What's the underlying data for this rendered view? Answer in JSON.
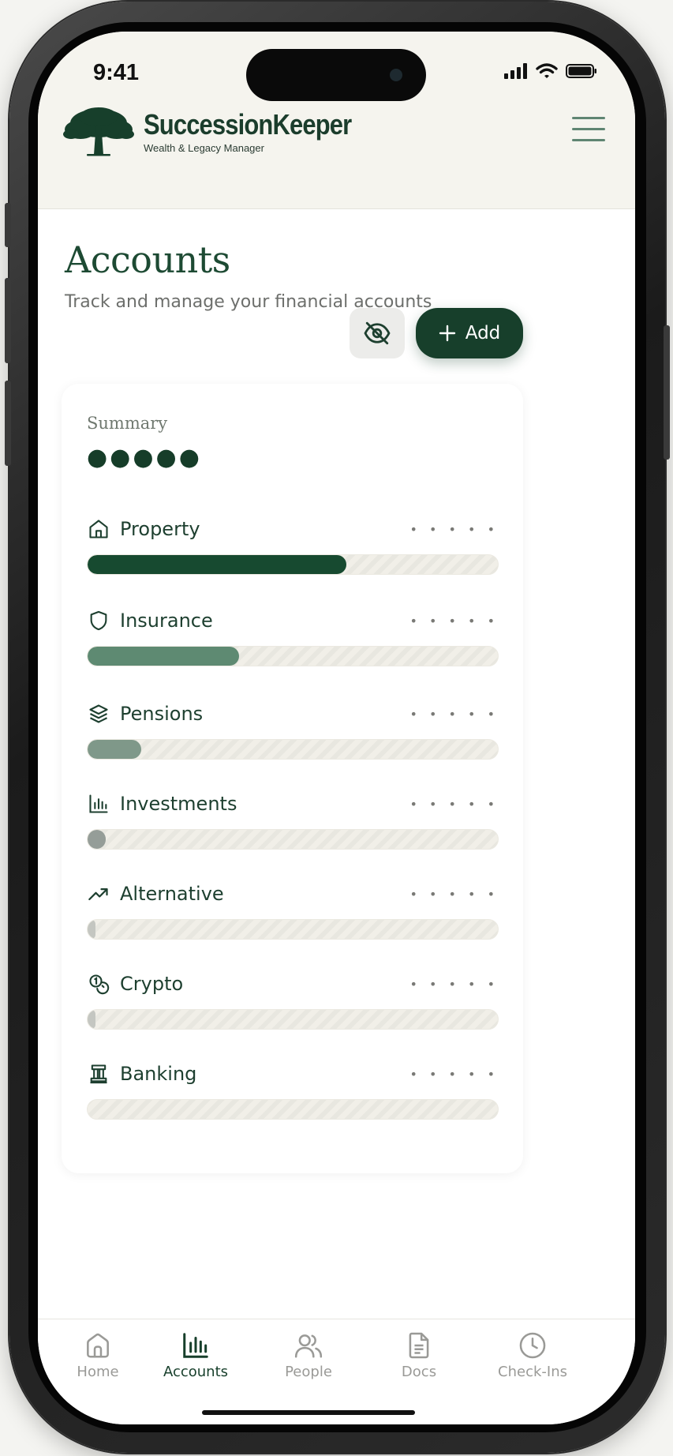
{
  "status": {
    "time": "9:41"
  },
  "brand": {
    "name": "SuccessionKeeper",
    "tagline": "Wealth & Legacy Manager"
  },
  "page": {
    "title": "Accounts",
    "subtitle": "Track and manage your financial accounts",
    "add_label": "Add"
  },
  "summary": {
    "label": "Summary",
    "value_masked": "●●●●●"
  },
  "categories": [
    {
      "label": "Property",
      "icon": "home-icon",
      "amount_masked": "• • • • •",
      "share": 0.63,
      "color": "#174a30"
    },
    {
      "label": "Insurance",
      "icon": "shield-icon",
      "amount_masked": "• • • • •",
      "share": 0.37,
      "color": "#5e8a72"
    },
    {
      "label": "Pensions",
      "icon": "layers-icon",
      "amount_masked": "• • • • •",
      "share": 0.13,
      "color": "#7f9889"
    },
    {
      "label": "Investments",
      "icon": "bar-chart-icon",
      "amount_masked": "• • • • •",
      "share": 0.045,
      "color": "#959d98"
    },
    {
      "label": "Alternative",
      "icon": "trending-up-icon",
      "amount_masked": "• • • • •",
      "share": 0.015,
      "color": "#c4c6c1"
    },
    {
      "label": "Crypto",
      "icon": "coins-icon",
      "amount_masked": "• • • • •",
      "share": 0.015,
      "color": "#c4c6c1"
    },
    {
      "label": "Banking",
      "icon": "bank-icon",
      "amount_masked": "• • • • •",
      "share": 0.0,
      "color": "#c4c6c1"
    }
  ],
  "tabs": [
    {
      "label": "Home",
      "icon": "home-icon",
      "active": false
    },
    {
      "label": "Accounts",
      "icon": "bar-chart-icon",
      "active": true
    },
    {
      "label": "People",
      "icon": "people-icon",
      "active": false
    },
    {
      "label": "Docs",
      "icon": "document-icon",
      "active": false
    },
    {
      "label": "Check-Ins",
      "icon": "clock-icon",
      "active": false
    }
  ],
  "colors": {
    "accent": "#173f2b",
    "header_bg": "#f5f4ee"
  }
}
